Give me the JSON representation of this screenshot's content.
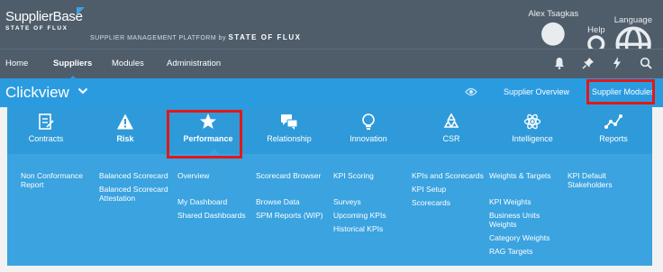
{
  "brand": {
    "name": "SupplierBase",
    "sub": "STATE OF FLUX",
    "platform_prefix": "SUPPLIER MANAGEMENT PLATFORM by",
    "platform_suffix": "STATE OF FLUX"
  },
  "user_menu": {
    "user": "Alex Tsagkas",
    "help": "Help",
    "language": "Language"
  },
  "nav": {
    "items": [
      "Home",
      "Suppliers",
      "Modules",
      "Administration"
    ]
  },
  "context": {
    "title": "Clickview",
    "links": {
      "overview": "Supplier Overview",
      "modules": "Supplier Modules"
    }
  },
  "modules": [
    "Contracts",
    "Risk",
    "Performance",
    "Relationship",
    "Innovation",
    "CSR",
    "Intelligence",
    "Reports"
  ],
  "submenu": {
    "col1": [
      "Non Conformance Report"
    ],
    "col2": [
      "Balanced Scorecard",
      "Balanced Scorecard Attestation"
    ],
    "col3": [
      "Overview",
      "My Dashboard",
      "Shared Dashboards"
    ],
    "col4": [
      "Scorecard Browser",
      "Browse Data",
      "SPM Reports (WIP)"
    ],
    "col5": [
      "KPI Scoring",
      "Surveys",
      "Upcoming KPIs",
      "Historical KPIs"
    ],
    "col6": [
      "KPIs and Scorecards",
      "KPI Setup",
      "Scorecards"
    ],
    "col7": [
      "Weights & Targets",
      "KPI Weights",
      "Business Units Weights",
      "Category Weights",
      "RAG Targets"
    ],
    "col8": [
      "KPI Default Stakeholders"
    ]
  }
}
